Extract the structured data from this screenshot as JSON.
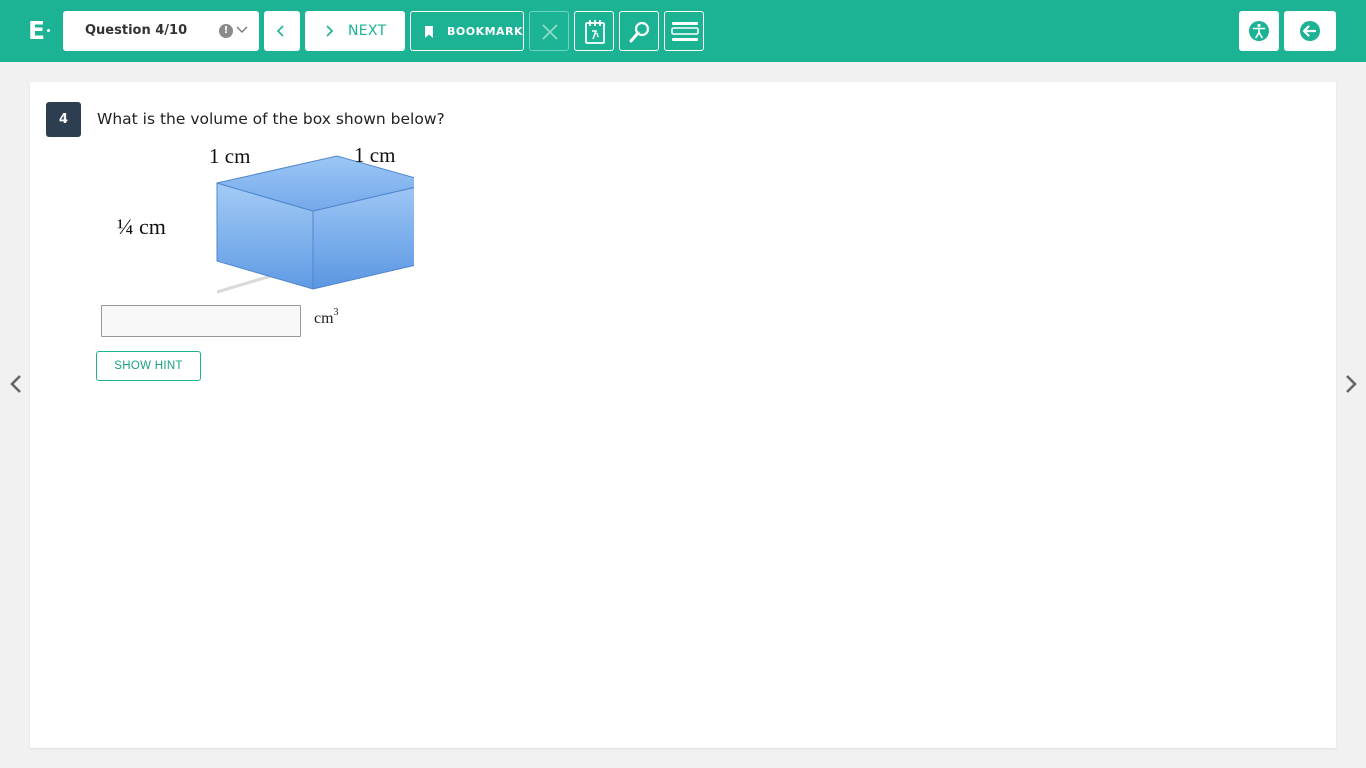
{
  "app": {
    "logo_letter": "E"
  },
  "toolbar": {
    "question_selector_label": "Question 4/10",
    "alert_glyph": "!",
    "next_label": "NEXT",
    "bookmark_label": "BOOKMARK"
  },
  "question": {
    "number": "4",
    "text": "What is the volume of the box shown below?",
    "figure": {
      "label_top_left": "1 cm",
      "label_top_right": "1 cm",
      "label_height": "¼  cm"
    },
    "answer": {
      "value": "",
      "placeholder": "",
      "unit_base": "cm",
      "unit_exponent": "3"
    },
    "hint_label": "SHOW HINT"
  },
  "colors": {
    "brand": "#1bb394",
    "question_badge": "#2c3e50",
    "box_front": "#8dbcf3",
    "box_top": "#7fb2ee"
  }
}
